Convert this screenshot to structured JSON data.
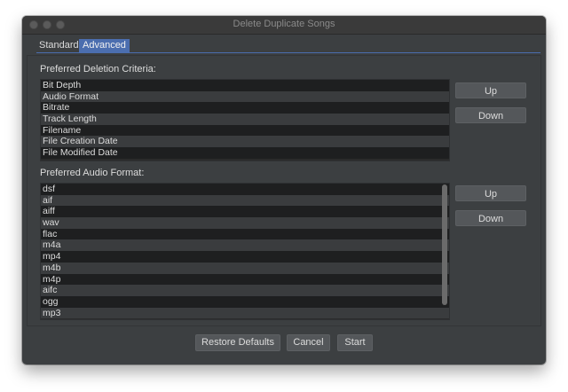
{
  "window": {
    "title": "Delete Duplicate Songs"
  },
  "tabs": [
    {
      "label": "Standard",
      "selected": false
    },
    {
      "label": "Advanced",
      "selected": true
    }
  ],
  "deletion_criteria": {
    "label": "Preferred Deletion Criteria:",
    "items": [
      "Bit Depth",
      "Audio Format",
      "Bitrate",
      "Track Length",
      "Filename",
      "File Creation Date",
      "File Modified Date"
    ],
    "up_label": "Up",
    "down_label": "Down"
  },
  "audio_format": {
    "label": "Preferred Audio Format:",
    "items": [
      "dsf",
      "aif",
      "aiff",
      "wav",
      "flac",
      "m4a",
      "mp4",
      "m4b",
      "m4p",
      "aifc",
      "ogg",
      "mp3"
    ],
    "up_label": "Up",
    "down_label": "Down"
  },
  "footer": {
    "restore_label": "Restore Defaults",
    "cancel_label": "Cancel",
    "start_label": "Start"
  }
}
